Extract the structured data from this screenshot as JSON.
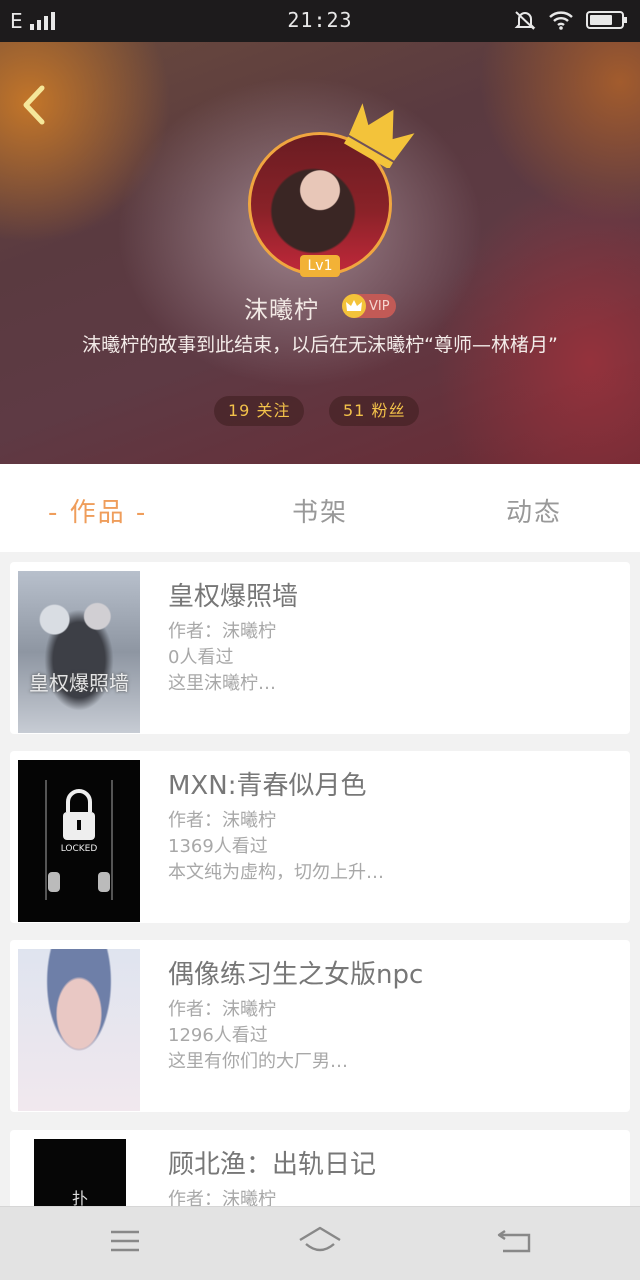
{
  "status_bar": {
    "carrier": "E",
    "time": "21:23"
  },
  "profile": {
    "level": "Lv1",
    "username": "沫曦柠",
    "vip_label": "VIP",
    "bio": "沫曦柠的故事到此结束，以后在无沫曦柠“尊师—林楮月”",
    "following": "19 关注",
    "fans": "51 粉丝"
  },
  "tabs": {
    "works": "- 作品 -",
    "shelf": "书架",
    "feed": "动态",
    "active": "works"
  },
  "books": [
    {
      "title": "皇权爆照墙",
      "author": "作者：沫曦柠",
      "views": "0人看过",
      "desc": "这里沫曦柠…",
      "cover_text": "皇权爆照墙"
    },
    {
      "title": "MXN:青春似月色",
      "author": "作者：沫曦柠",
      "views": "1369人看过",
      "desc": "本文纯为虚构，切勿上升…",
      "cover_text": "LOCKED"
    },
    {
      "title": "偶像练习生之女版npc",
      "author": "作者：沫曦柠",
      "views": "1296人看过",
      "desc": "这里有你们的大厂男…",
      "cover_text": ""
    },
    {
      "title": "顾北渔：出轨日记",
      "author": "作者：沫曦柠",
      "views": "",
      "desc": "",
      "cover_text": "扑"
    }
  ],
  "colors": {
    "accent": "#ef9d5b",
    "level_badge": "#f2b236",
    "stat_text": "#f2c14a",
    "avatar_ring": "#f0a640"
  },
  "icons": {
    "back": "chevron-left-icon",
    "crown": "crown-icon",
    "vip": "crown-icon",
    "mute": "bell-muted-icon",
    "wifi": "wifi-icon",
    "battery": "battery-icon",
    "nav_menu": "menu-icon",
    "nav_home": "home-icon",
    "nav_back": "return-icon"
  }
}
